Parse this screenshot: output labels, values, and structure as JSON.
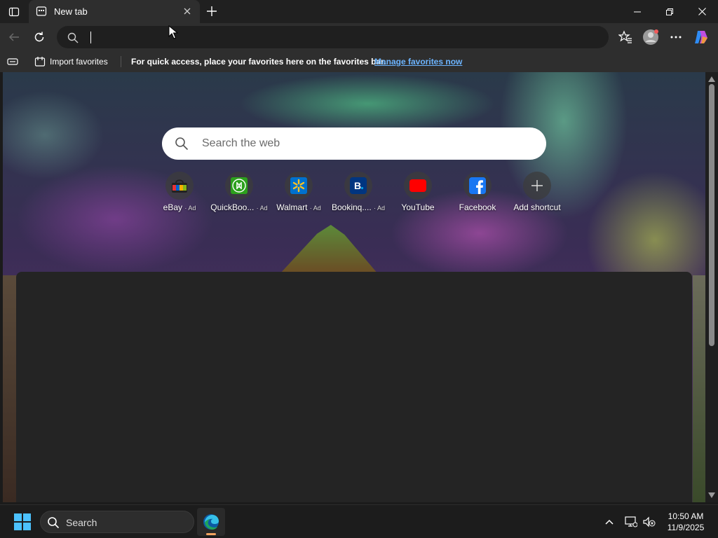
{
  "browser": {
    "tab": {
      "title": "New tab"
    },
    "address_bar": {
      "value": "",
      "placeholder": ""
    }
  },
  "favorites_bar": {
    "import_label": "Import favorites",
    "message": "For quick access, place your favorites here on the favorites bar.",
    "link": "Manage favorites now"
  },
  "new_tab_page": {
    "search_placeholder": "Search the web",
    "shortcuts": [
      {
        "label": "eBay",
        "ad": "· Ad",
        "icon": "ebay-icon"
      },
      {
        "label": "QuickBoo...",
        "ad": "· Ad",
        "icon": "quickbooks-icon"
      },
      {
        "label": "Walmart",
        "ad": "· Ad",
        "icon": "walmart-icon"
      },
      {
        "label": "Bookinq....",
        "ad": "· Ad",
        "icon": "booking-icon"
      },
      {
        "label": "YouTube",
        "ad": "",
        "icon": "youtube-icon"
      },
      {
        "label": "Facebook",
        "ad": "",
        "icon": "facebook-icon"
      },
      {
        "label": "Add shortcut",
        "ad": "",
        "icon": "plus-icon"
      }
    ]
  },
  "taskbar": {
    "search_label": "Search",
    "time": "10:50 AM",
    "date": "11/9/2025"
  },
  "colors": {
    "accent_link": "#6cb4ff",
    "taskbar_bg": "#1c1c1c",
    "chrome_bg": "#2e2e2e"
  }
}
